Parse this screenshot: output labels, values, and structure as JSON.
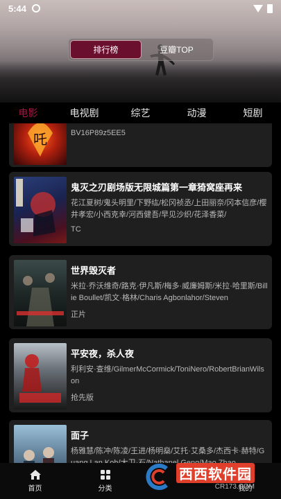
{
  "status_bar": {
    "time": "5:44"
  },
  "header": {
    "segments": [
      {
        "label": "排行榜",
        "active": true
      },
      {
        "label": "豆瓣TOP",
        "active": false
      }
    ]
  },
  "category_tabs": [
    {
      "label": "电影",
      "active": true
    },
    {
      "label": "电视剧",
      "active": false
    },
    {
      "label": "综艺",
      "active": false
    },
    {
      "label": "动漫",
      "active": false
    },
    {
      "label": "短剧",
      "active": false
    }
  ],
  "movies": [
    {
      "title": "",
      "cast": "BV16P89z5EE5",
      "tag": ""
    },
    {
      "title": "鬼灭之刃剧场版无限城篇第一章猗窝座再来",
      "cast": "花江夏树/鬼头明里/下野纮/松冈祯丞/上田丽奈/冈本信彦/樱井孝宏/小西克幸/河西健吾/早见沙织/花泽香菜/",
      "tag": "TC"
    },
    {
      "title": "世界毁灭者",
      "cast": "米拉·乔沃维奇/路克·伊凡斯/梅多·威廉姆斯/米拉·哈里斯/Billie Boullet/凯文·格林/Charis Agbonlahor/Steven",
      "tag": "正片"
    },
    {
      "title": "平安夜，杀人夜",
      "cast": "利利安·查维/GilmerMcCormick/ToniNero/RobertBrianWilson",
      "tag": "抢先版"
    },
    {
      "title": "面子",
      "cast": "杨雅慧/陈冲/陈凌/王进/杨明燊/艾托·艾桑多/杰西卡·赫特/Guang Lan Koh/大卫·石/Nathanel Geng/Mao Zhao",
      "tag": ""
    }
  ],
  "bottom_nav": [
    {
      "label": "首页",
      "icon": "home-icon"
    },
    {
      "label": "分类",
      "icon": "category-icon"
    },
    {
      "label": "",
      "icon": ""
    },
    {
      "label": "我的",
      "icon": "profile-icon"
    }
  ],
  "watermark": {
    "main": "西西软件园",
    "sub": "CR173.COM"
  }
}
